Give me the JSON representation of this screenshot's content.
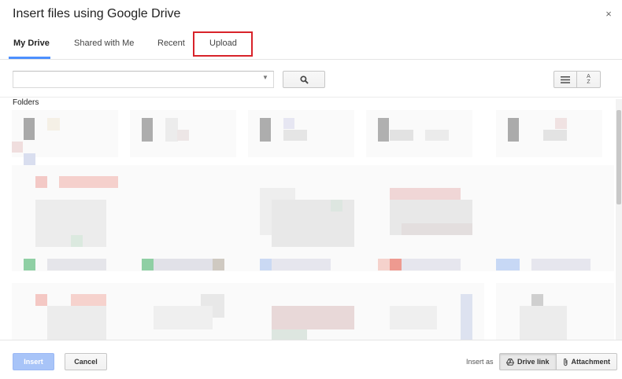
{
  "dialog": {
    "title": "Insert files using Google Drive",
    "close_glyph": "×"
  },
  "tabs": [
    {
      "label": "My Drive",
      "active": true
    },
    {
      "label": "Shared with Me",
      "active": false
    },
    {
      "label": "Recent",
      "active": false
    },
    {
      "label": "Upload",
      "active": false
    }
  ],
  "search": {
    "value": "",
    "placeholder": "",
    "button_icon": "search-icon"
  },
  "view": {
    "list_icon": "list-view-icon",
    "sort_glyph_top": "A",
    "sort_glyph_bottom": "Z"
  },
  "content": {
    "section_label": "Folders"
  },
  "footer": {
    "insert_label": "Insert",
    "cancel_label": "Cancel",
    "insert_as_label": "Insert as",
    "drive_link_label": "Drive link",
    "attachment_label": "Attachment"
  },
  "colors": {
    "accent": "#4d90fe",
    "highlight": "#d8232a",
    "insert_disabled": "#a8c4f8"
  }
}
